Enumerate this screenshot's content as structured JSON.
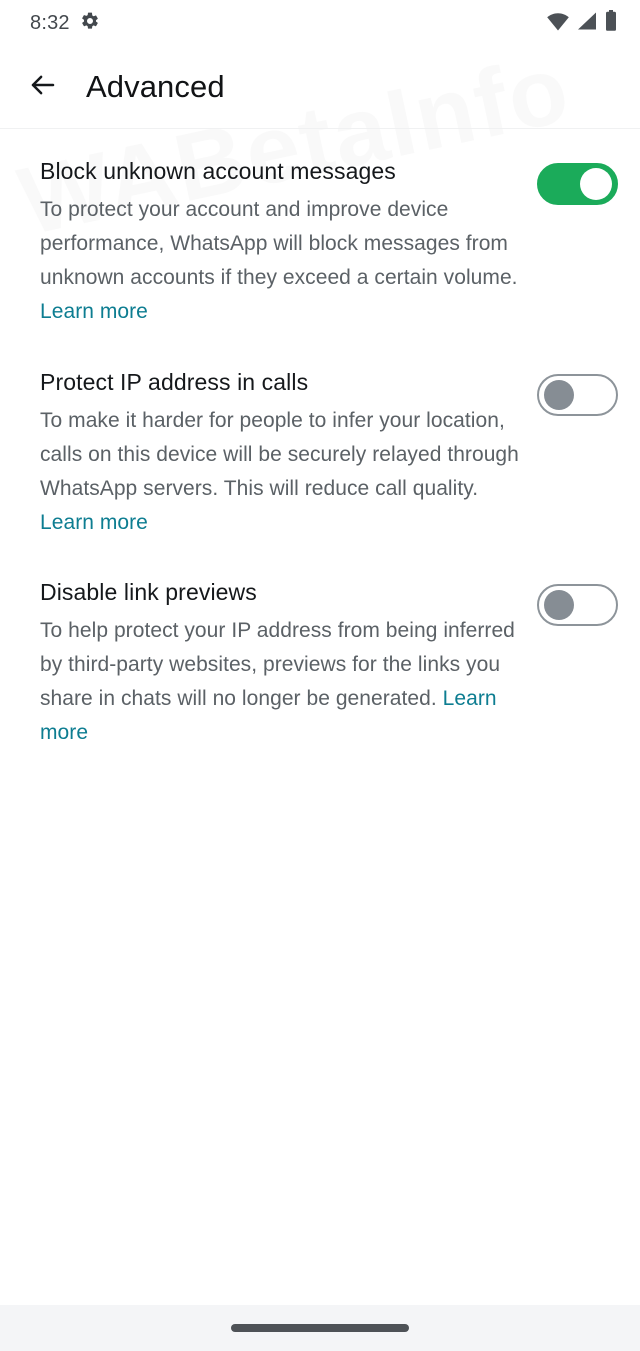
{
  "status_bar": {
    "time": "8:32",
    "icons": {
      "settings": "gear-icon",
      "wifi": "wifi-icon",
      "cellular": "cellular-signal-icon",
      "battery": "battery-full-icon"
    }
  },
  "app_bar": {
    "back_icon": "back-arrow-icon",
    "title": "Advanced"
  },
  "watermark": {
    "text": "WABetaInfo"
  },
  "colors": {
    "toggle_on": "#1bab5a",
    "toggle_off_border": "#8d949a",
    "toggle_off_knob": "#868d94",
    "link": "#0d7d91",
    "title": "#15181b",
    "description": "#5b6166",
    "nav_bar_bg": "#f4f5f7"
  },
  "settings": [
    {
      "title": "Block unknown account messages",
      "description": "To protect your account and improve device performance, WhatsApp will block messages from unknown accounts if they exceed a certain volume. ",
      "link_label": "Learn more",
      "link_inline": true,
      "toggle_state": "on"
    },
    {
      "title": "Protect IP address in calls",
      "description": "To make it harder for people to infer your location, calls on this device will be securely relayed through WhatsApp servers. This will reduce call quality. ",
      "link_label": "Learn more",
      "link_inline": false,
      "toggle_state": "off"
    },
    {
      "title": "Disable link previews",
      "description": "To help protect your IP address from being inferred by third-party websites, previews for the links you share in chats will no longer be generated. ",
      "link_label": "Learn more",
      "link_inline": true,
      "toggle_state": "off"
    }
  ],
  "nav_bar": {
    "handle": "gesture-home-handle"
  }
}
